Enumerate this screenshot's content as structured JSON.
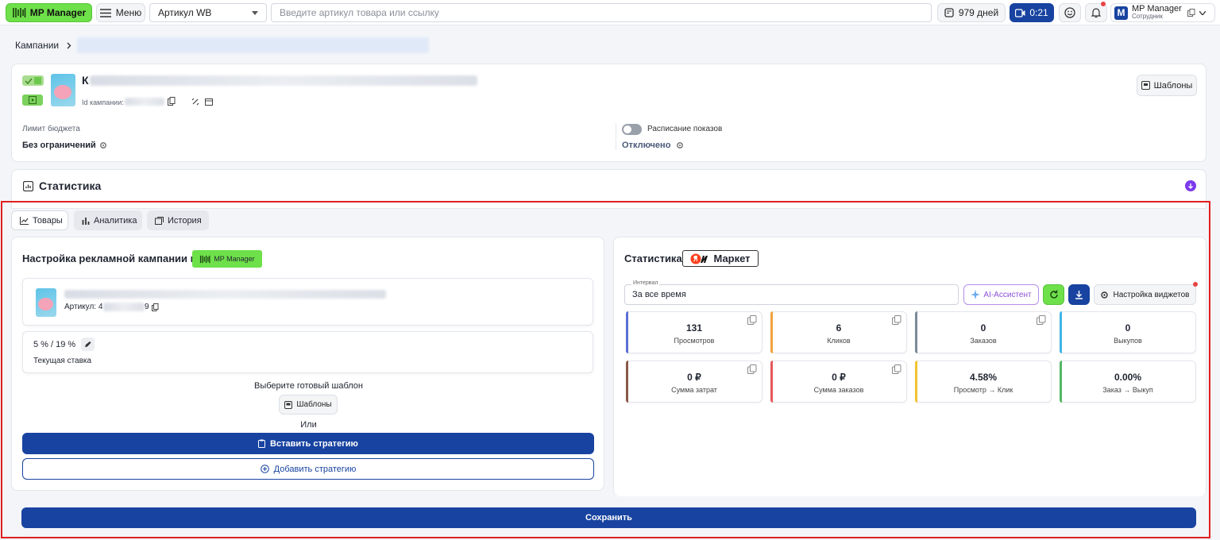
{
  "topbar": {
    "logo_label": "MP Manager",
    "menu_label": "Меню",
    "select_value": "Артикул WB",
    "search_placeholder": "Введите артикул товара или ссылку",
    "days_label": "979 дней",
    "timer_label": "0:21",
    "user_name": "MP Manager",
    "user_role": "Сотрудник",
    "avatar_letter": "M"
  },
  "breadcrumb": {
    "root": "Кампании"
  },
  "campaign": {
    "name_initial": "К",
    "id_label": "Id кампании:",
    "templates_label": "Шаблоны",
    "budget_label": "Лимит бюджета",
    "budget_value": "Без ограничений",
    "schedule_label": "Расписание показов",
    "schedule_value": "Отключено"
  },
  "stats_section": {
    "title": "Статистика"
  },
  "tabs": [
    {
      "label": "Товары"
    },
    {
      "label": "Аналитика"
    },
    {
      "label": "История"
    }
  ],
  "settings": {
    "title": "Настройка рекламной кампании в",
    "badge_label": "MP Manager",
    "article_label": "Артикул: 4",
    "article_suffix": "9",
    "rate": "5 % / 19 %",
    "rate_label": "Текущая ставка",
    "choose_template": "Выберите готовый шаблон",
    "templates_button": "Шаблоны",
    "or_label": "Или",
    "insert_strategy": "Вставить стратегию",
    "add_strategy": "Добавить стратегию"
  },
  "statistics": {
    "title": "Статистика",
    "market_label": "Маркет",
    "interval_label": "Интервал",
    "interval_value": "За все время",
    "ai_label": "AI-Ассистент",
    "widgets_label": "Настройка виджетов",
    "metrics": [
      {
        "value": "131",
        "label": "Просмотров",
        "color": "#5b6fd6"
      },
      {
        "value": "6",
        "label": "Кликов",
        "color": "#f0a23b"
      },
      {
        "value": "0",
        "label": "Заказов",
        "color": "#7b8a99"
      },
      {
        "value": "0",
        "label": "Выкупов",
        "color": "#3fb6e8"
      },
      {
        "value": "0 ₽",
        "label": "Сумма затрат",
        "color": "#8a5a4a"
      },
      {
        "value": "0 ₽",
        "label": "Сумма заказов",
        "color": "#e6585a"
      },
      {
        "value": "4.58%",
        "label": "Просмотр → Клик",
        "color": "#f2c230"
      },
      {
        "value": "0.00%",
        "label": "Заказ → Выкуп",
        "color": "#53b865"
      }
    ]
  },
  "save_label": "Сохранить",
  "colors": {
    "accent": "#1843a0",
    "brand_green": "#6ee04a",
    "highlight": "#e02020"
  }
}
